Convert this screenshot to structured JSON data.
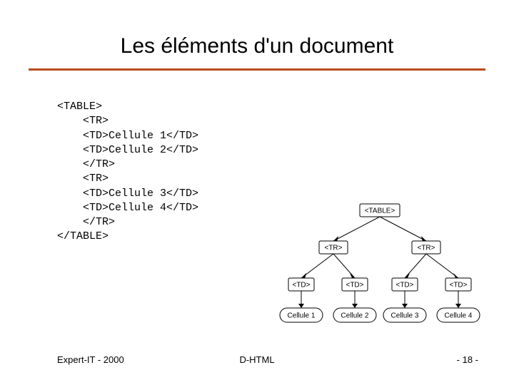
{
  "title": "Les éléments d'un document",
  "code": {
    "l1": "<TABLE>",
    "l2": "    <TR>",
    "l3": "    <TD>Cellule 1</TD>",
    "l4": "    <TD>Cellule 2</TD>",
    "l5": "    </TR>",
    "l6": "    <TR>",
    "l7": "    <TD>Cellule 3</TD>",
    "l8": "    <TD>Cellule 4</TD>",
    "l9": "    </TR>",
    "l10": "</TABLE>"
  },
  "diagram": {
    "root": "<TABLE>",
    "row": "<TR>",
    "cell": "<TD>",
    "leaf1": "Cellule 1",
    "leaf2": "Cellule 2",
    "leaf3": "Cellule 3",
    "leaf4": "Cellule 4"
  },
  "footer": {
    "left": "Expert-IT - 2000",
    "center": "D-HTML",
    "right": "- 18 -"
  }
}
